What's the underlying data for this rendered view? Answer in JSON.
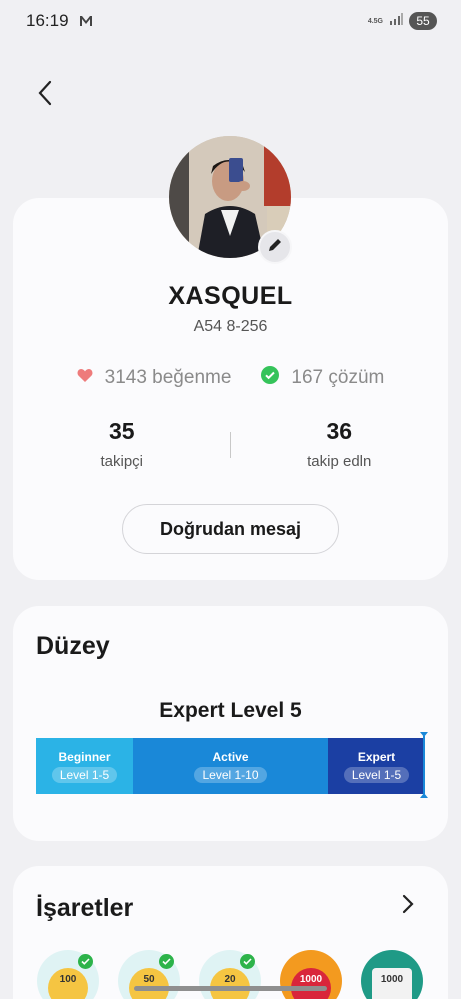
{
  "status_bar": {
    "time": "16:19",
    "network": "4.5G",
    "battery": "55"
  },
  "profile": {
    "username": "XASQUEL",
    "subtitle": "A54 8-256",
    "likes": "3143 beğenme",
    "solutions": "167 çözüm",
    "followers_count": "35",
    "followers_label": "takipçi",
    "following_count": "36",
    "following_label": "takip edln",
    "message_button": "Doğrudan mesaj"
  },
  "level": {
    "section_title": "Düzey",
    "current": "Expert Level 5",
    "segments": [
      {
        "name": "Beginner",
        "range": "Level 1-5",
        "color": "#2bb3e6"
      },
      {
        "name": "Active",
        "range": "Level 1-10",
        "color": "#1a88d8"
      },
      {
        "name": "Expert",
        "range": "Level 1-5",
        "color": "#1b3fa3"
      }
    ],
    "progress_fraction": 1.0
  },
  "badges": {
    "section_title": "İşaretler",
    "items": [
      {
        "name": "badge-100",
        "text": "100",
        "color": "#dff3f4",
        "inner": "#f5c542",
        "checked": true
      },
      {
        "name": "badge-50",
        "text": "50",
        "color": "#dff3f4",
        "inner": "#f5c542",
        "checked": true
      },
      {
        "name": "badge-20",
        "text": "20",
        "color": "#dff3f4",
        "inner": "#f5c542",
        "checked": true
      },
      {
        "name": "badge-1000-heart",
        "text": "1000",
        "color": "#f39a1f",
        "inner": "#d9263b",
        "checked": false
      },
      {
        "name": "badge-1000-book",
        "text": "1000",
        "color": "#1f9a86",
        "inner": "#f2f2f2",
        "checked": false
      }
    ]
  },
  "colors": {
    "like_icon": "#ee7b7b",
    "solution_icon": "#35c35a",
    "accent_marker": "#1a88d8"
  }
}
